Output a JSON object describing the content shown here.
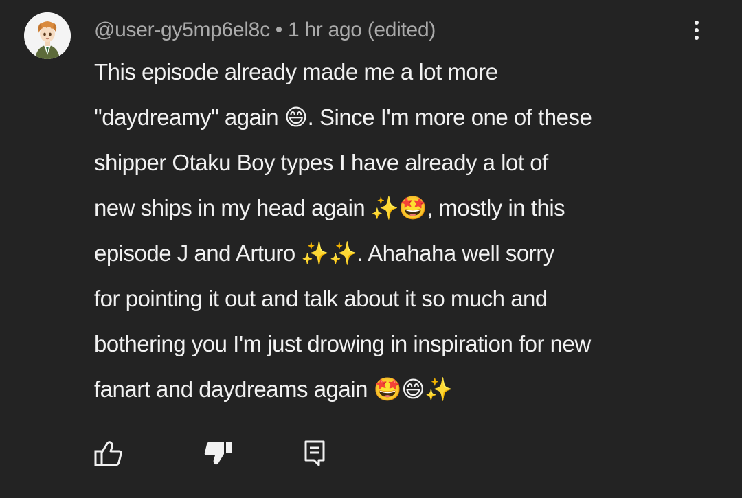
{
  "comment": {
    "author": "@user-gy5mp6el8c",
    "separator": "•",
    "timestamp": "1 hr ago (edited)",
    "lines": [
      "This episode already made me a lot more",
      "\"daydreamy\" again 😄. Since I'm more one of these",
      "shipper Otaku Boy types I have already a lot of",
      "new ships in my head again ✨🤩, mostly in this",
      "episode J and Arturo ✨✨. Ahahaha well sorry",
      "for pointing it out and talk about it so much and",
      "bothering you I'm just drowing in inspiration for new",
      "fanart and daydreams again 🤩😄✨"
    ]
  },
  "actions": {
    "like_icon": "thumbs-up-outline-icon",
    "dislike_icon": "thumbs-down-filled-icon",
    "reply_icon": "reply-comment-icon"
  },
  "menu": {
    "icon": "more-vertical-icon"
  },
  "colors": {
    "background": "#232323",
    "text": "#f1f1f1",
    "meta": "#aaaaaa",
    "emoji_yellow": "#f7c32e"
  }
}
